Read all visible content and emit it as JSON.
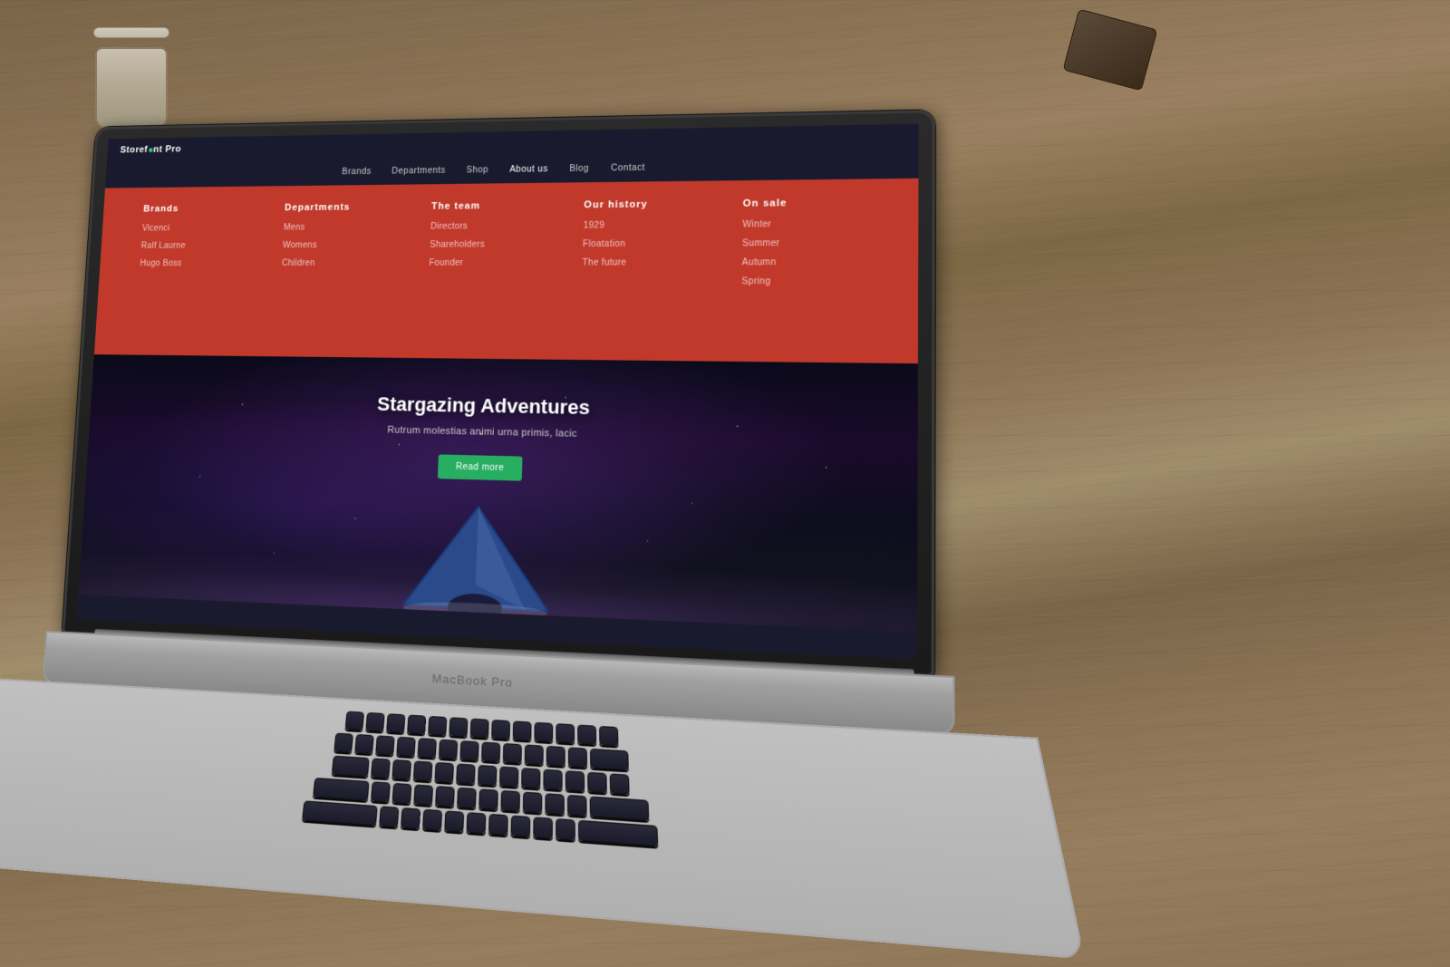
{
  "desk": {
    "label": "wooden desk background"
  },
  "macbook": {
    "model_label": "MacBook Pro"
  },
  "website": {
    "logo": "Storefront Pro",
    "nav": {
      "items": [
        {
          "id": "brands",
          "label": "Brands",
          "active": false
        },
        {
          "id": "departments",
          "label": "Departments",
          "active": false
        },
        {
          "id": "shop",
          "label": "Shop",
          "active": false
        },
        {
          "id": "about",
          "label": "About us",
          "active": false
        },
        {
          "id": "blog",
          "label": "Blog",
          "active": false
        },
        {
          "id": "contact",
          "label": "Contact",
          "active": false
        }
      ]
    },
    "mega_menu": {
      "columns": [
        {
          "id": "col1",
          "title": "Brands",
          "items": [
            "Vicenci",
            "Ralf Laurne",
            "Hugo Boss"
          ]
        },
        {
          "id": "col2",
          "title": "Departments",
          "items": [
            "Mens",
            "Womens",
            "Children"
          ]
        },
        {
          "id": "col3",
          "title": "The team",
          "items": [
            "Directors",
            "Shareholders",
            "Founder"
          ]
        },
        {
          "id": "col4",
          "title": "Our history",
          "items": [
            "1929",
            "Floatation",
            "The future"
          ]
        },
        {
          "id": "col5",
          "title": "On sale",
          "items": [
            "Winter",
            "Summer",
            "Autumn",
            "Spring"
          ]
        }
      ]
    },
    "hero": {
      "title": "Stargazing Adventures",
      "subtitle": "Rutrum molestias animi urna primis, lacic",
      "cta_button": "Read more"
    }
  }
}
